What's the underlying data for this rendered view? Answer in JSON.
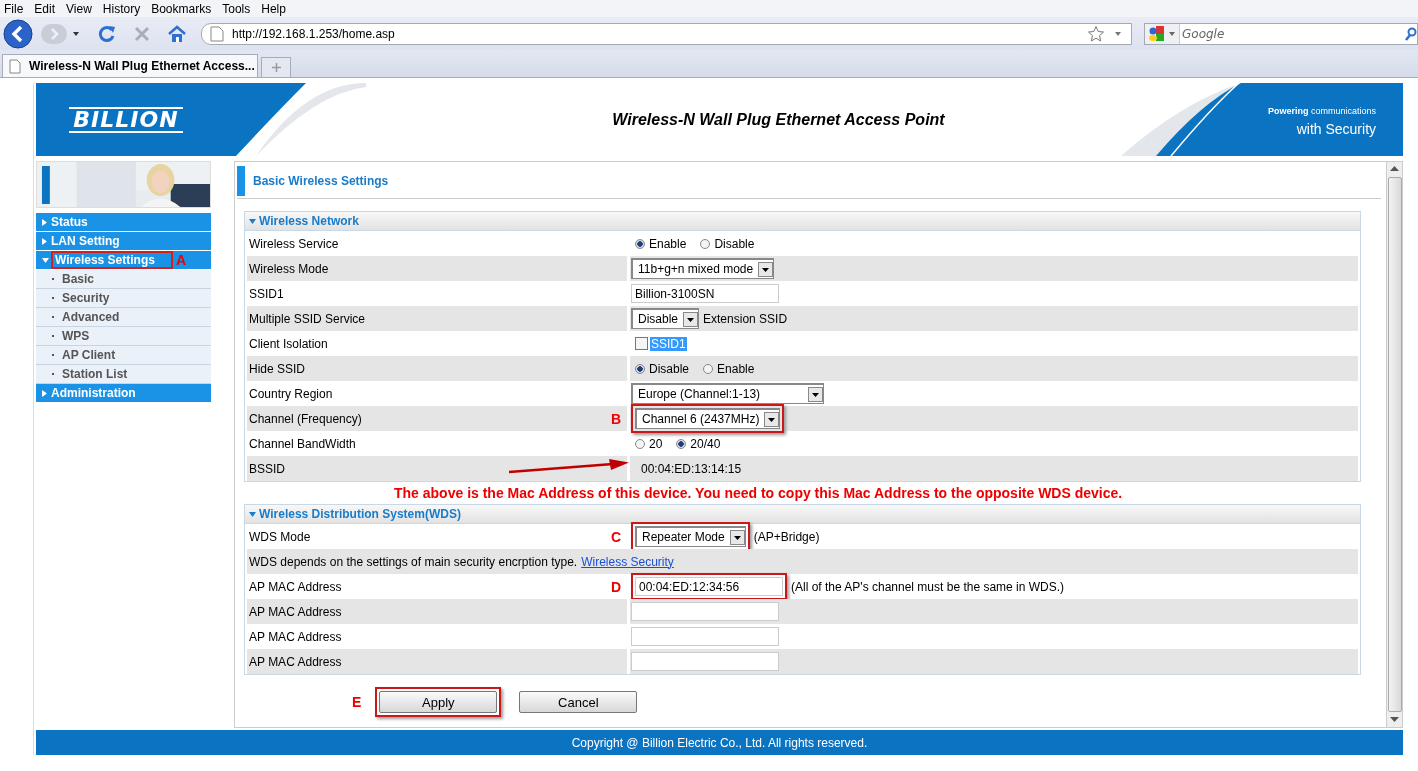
{
  "browser": {
    "menu": [
      "File",
      "Edit",
      "View",
      "History",
      "Bookmarks",
      "Tools",
      "Help"
    ],
    "address": "http://192.168.1.253/home.asp",
    "search_placeholder": "Google",
    "tabs": [
      {
        "title": "Wireless-N Wall Plug Ethernet Access...",
        "selected": true
      }
    ]
  },
  "header": {
    "logo": "BILLION",
    "title": "Wireless-N Wall Plug Ethernet Access Point",
    "tagline": [
      "**Powering** communications",
      "with Security"
    ]
  },
  "sidebar": [
    {
      "label": "Status",
      "expanded": false
    },
    {
      "label": "LAN Setting",
      "expanded": false
    },
    {
      "label": "Wireless Settings",
      "expanded": true,
      "highlighted": true,
      "marker": "A",
      "children": [
        {
          "label": "Basic"
        },
        {
          "label": "Security"
        },
        {
          "label": "Advanced"
        },
        {
          "label": "WPS"
        },
        {
          "label": "AP Client"
        },
        {
          "label": "Station List"
        }
      ]
    },
    {
      "label": "Administration",
      "expanded": false
    }
  ],
  "page_title": "Basic Wireless Settings",
  "sections": [
    {
      "title": "Wireless Network",
      "expanded": true,
      "rows": [
        {
          "label": "Wireless Service",
          "kind": "radio",
          "options": [
            {
              "label": "Enable",
              "selected": true
            },
            {
              "label": "Disable",
              "selected": false
            }
          ]
        },
        {
          "label": "Wireless Mode",
          "kind": "select",
          "value": "11b+g+n mixed mode"
        },
        {
          "label": "SSID1",
          "kind": "text",
          "value": "Billion-3100SN"
        },
        {
          "label": "Multiple SSID Service",
          "kind": "select",
          "value": "Disable",
          "note": "Extension SSID"
        },
        {
          "label": "Client Isolation",
          "kind": "checkbox",
          "checked": false,
          "option": "SSID1",
          "option_selected": true
        },
        {
          "label": "Hide SSID",
          "kind": "radio",
          "options": [
            {
              "label": "Disable",
              "selected": true
            },
            {
              "label": "Enable",
              "selected": false
            }
          ]
        },
        {
          "label": "Country Region",
          "kind": "select",
          "value": "Europe (Channel:1-13)"
        },
        {
          "label": "Channel (Frequency)",
          "kind": "select",
          "value": "Channel 6 (2437MHz)",
          "highlighted": true,
          "marker": "B"
        },
        {
          "label": "Channel BandWidth",
          "kind": "radio",
          "options": [
            {
              "label": "20",
              "selected": false
            },
            {
              "label": "20/40",
              "selected": true
            }
          ]
        },
        {
          "label": "BSSID",
          "kind": "value",
          "value": "00:04:ED:13:14:15",
          "arrow": true
        }
      ],
      "note": "The above is the Mac Address of this device. You need to copy this Mac Address to the opposite WDS device."
    },
    {
      "title": "Wireless Distribution System(WDS)",
      "expanded": true,
      "rows": [
        {
          "label": "WDS Mode",
          "kind": "select",
          "value": "Repeater Mode",
          "note": "(AP+Bridge)",
          "highlighted": true,
          "marker": "C"
        },
        {
          "kind": "info",
          "text": "WDS depends on the settings of main security encrption type.",
          "link": "Wireless Security"
        },
        {
          "label": "AP MAC Address",
          "kind": "text",
          "value": "00:04:ED:12:34:56",
          "note": "(All of the AP's channel must be the same in WDS.)",
          "highlighted": true,
          "marker": "D"
        },
        {
          "label": "AP MAC Address",
          "kind": "text"
        },
        {
          "label": "AP MAC Address",
          "kind": "text"
        },
        {
          "label": "AP MAC Address",
          "kind": "text"
        }
      ]
    }
  ],
  "buttons": [
    {
      "label": "Apply",
      "highlighted": true,
      "marker": "E"
    },
    {
      "label": "Cancel"
    }
  ],
  "footer": "Copyright @ Billion Electric Co., Ltd. All rights reserved."
}
